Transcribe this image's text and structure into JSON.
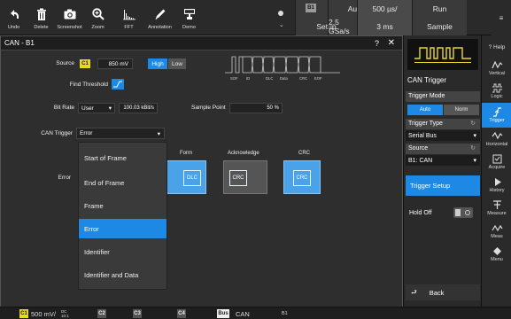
{
  "toolbar": {
    "buttons": [
      {
        "label": "Undo",
        "icon": "undo-icon"
      },
      {
        "label": "Delete",
        "icon": "trash-icon"
      },
      {
        "label": "Screenshot",
        "icon": "camera-icon"
      },
      {
        "label": "Zoom",
        "icon": "zoom-icon"
      },
      {
        "label": "FFT",
        "icon": "fft-icon"
      },
      {
        "label": "Annotation",
        "icon": "pen-icon"
      },
      {
        "label": "Demo",
        "icon": "demo-icon"
      }
    ],
    "trigger_badge": "B1",
    "trigger_mode": "Auto",
    "trigger_setup": "Setup",
    "timebase": "500 µs/",
    "sample_rate": "2.5 GSa/s",
    "acq_time": "3 ms",
    "run_state": "Run",
    "acq_mode": "Sample",
    "dot_arrow": "⌄"
  },
  "dialog": {
    "title": "CAN - B1",
    "help": "?",
    "close": "✕",
    "source_label": "Source",
    "source_channel": "C1",
    "source_level": "850 mV",
    "high_label": "High",
    "low_label": "Low",
    "find_threshold_label": "Find Threshold",
    "bitrate_label": "Bit Rate",
    "bitrate_mode": "User",
    "bitrate_value": "100.03 kBit/s",
    "sample_point_label": "Sample Point",
    "sample_point_value": "50 %",
    "can_trigger_label": "CAN Trigger",
    "can_trigger_value": "Error",
    "error_label": "Error",
    "frame_fields": [
      "SOF",
      "ID",
      "DLC",
      "Data",
      "CRC",
      "EOF"
    ],
    "error_columns": [
      {
        "header": "Form",
        "box": "DLC"
      },
      {
        "header": "Acknowledge",
        "box": "CRC"
      },
      {
        "header": "CRC",
        "box": "CRC"
      }
    ],
    "dropdown_items": [
      "Start of Frame",
      "End of Frame",
      "Frame",
      "Error",
      "Identifier",
      "Identifier and Data"
    ],
    "dropdown_selected": "Error"
  },
  "trigger_panel": {
    "title": "CAN Trigger",
    "trigger_mode_label": "Trigger Mode",
    "auto_label": "Auto",
    "norm_label": "Norm",
    "trigger_type_label": "Trigger Type",
    "trigger_type_value": "Serial Bus",
    "source_label": "Source",
    "source_value": "B1: CAN",
    "trigger_setup_label": "Trigger Setup",
    "holdoff_label": "Hold Off",
    "back_label": "Back"
  },
  "sidebar": {
    "items": [
      {
        "label": "? Help",
        "icon": "help-icon"
      },
      {
        "label": "Vertical",
        "icon": "vertical-icon"
      },
      {
        "label": "Logic",
        "icon": "logic-icon"
      },
      {
        "label": "Trigger",
        "icon": "trigger-icon"
      },
      {
        "label": "Horizontal",
        "icon": "horizontal-icon"
      },
      {
        "label": "Acquire",
        "icon": "acquire-icon"
      },
      {
        "label": "History",
        "icon": "history-icon"
      },
      {
        "label": "Measure",
        "icon": "measure-icon"
      },
      {
        "label": "Meas",
        "icon": "meas-icon"
      },
      {
        "label": "Menu",
        "icon": "menu-icon"
      }
    ]
  },
  "bottom_bar": {
    "c1_label": "C1",
    "c1_scale": "500 mV/",
    "c1_coupling": "DC",
    "c1_bw": "10:1",
    "c2_label": "C2",
    "c3_label": "C3",
    "c4_label": "C4",
    "bus_label": "Bus",
    "bus_type": "CAN",
    "b1_label": "B1"
  },
  "colors": {
    "accent": "#1e88e5",
    "c1_yellow": "#e8d82a",
    "error_box": "#4aa3e8"
  }
}
